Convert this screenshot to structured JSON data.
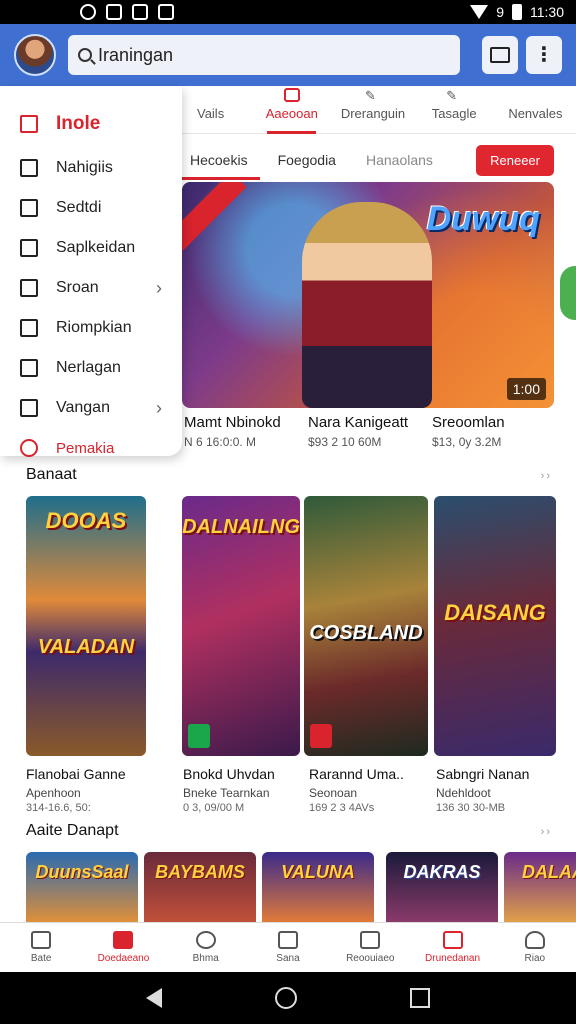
{
  "status_bar": {
    "signal_text": "9",
    "time": "11:30"
  },
  "app_bar": {
    "search_value": "Iraningan"
  },
  "top_tabs": [
    {
      "label": "Vails"
    },
    {
      "label": "Aaeooan"
    },
    {
      "label": "Dreranguin"
    },
    {
      "label": "Tasagle"
    },
    {
      "label": "Nenvales"
    }
  ],
  "chips": [
    {
      "label": "Hecoekis"
    },
    {
      "label": "Foegodia"
    },
    {
      "label": "Hanaolans"
    }
  ],
  "chip_button": "Reneeer",
  "hero": {
    "logo": "Duwuq",
    "ribbon": "",
    "badge": "1:00"
  },
  "hero_titles": [
    {
      "title": "Mamt Nbinokd",
      "sub": "N 6 16:0:0. M"
    },
    {
      "title": "Nara Kanigeatt",
      "sub": "$93 2 10 60M"
    },
    {
      "title": "Sreoomlan",
      "sub": "$13, 0y 3.2M"
    }
  ],
  "drawer": {
    "items": [
      {
        "label": "Inole"
      },
      {
        "label": "Nahigiis"
      },
      {
        "label": "Sedtdi"
      },
      {
        "label": "Saplkeidan"
      },
      {
        "label": "Sroan"
      },
      {
        "label": "Riompkian"
      },
      {
        "label": "Nerlagan"
      },
      {
        "label": "Vangan"
      },
      {
        "label": "Pemakia"
      }
    ]
  },
  "section1": {
    "title": "Banaat",
    "more": "››"
  },
  "section2": {
    "title": "Aaite Danapt",
    "more": "››"
  },
  "grid_cards": [
    {
      "logo_top": "DOOAS",
      "logo_bottom": "VALADAN"
    },
    {
      "logo_top": "DALNAILNG",
      "logo_bottom": ""
    },
    {
      "logo_top": "",
      "logo_bottom": "COSBLAND"
    },
    {
      "logo_top": "",
      "logo_bottom": "DAISANG"
    }
  ],
  "grid_titles": [
    {
      "title": "Flanobai Ganne",
      "s1": "Apenhoon",
      "s2": "314-16.6, 50:"
    },
    {
      "title": "Bnokd Uhvdan",
      "s1": "Bneke Tearnkan",
      "s2": "0 3, 09/00 M"
    },
    {
      "title": "Rarannd Uma..",
      "s1": "Seonoan",
      "s2": "169 2 3 4AVs"
    },
    {
      "title": "Sabngri Nanan",
      "s1": "Ndehldoot",
      "s2": "136 30 30-MB"
    }
  ],
  "thumbs": [
    {
      "label": "DuunsSaal"
    },
    {
      "label": "BAYBAMS"
    },
    {
      "label": "VALUNA"
    },
    {
      "label": "DAKRAS"
    },
    {
      "label": "DALAAN"
    }
  ],
  "bottom_nav": [
    {
      "label": "Bate"
    },
    {
      "label": "Doedaeano"
    },
    {
      "label": "Bhma"
    },
    {
      "label": "Sana"
    },
    {
      "label": "Reoouiaeo"
    },
    {
      "label": "Drunedanan"
    },
    {
      "label": "Riao"
    }
  ]
}
